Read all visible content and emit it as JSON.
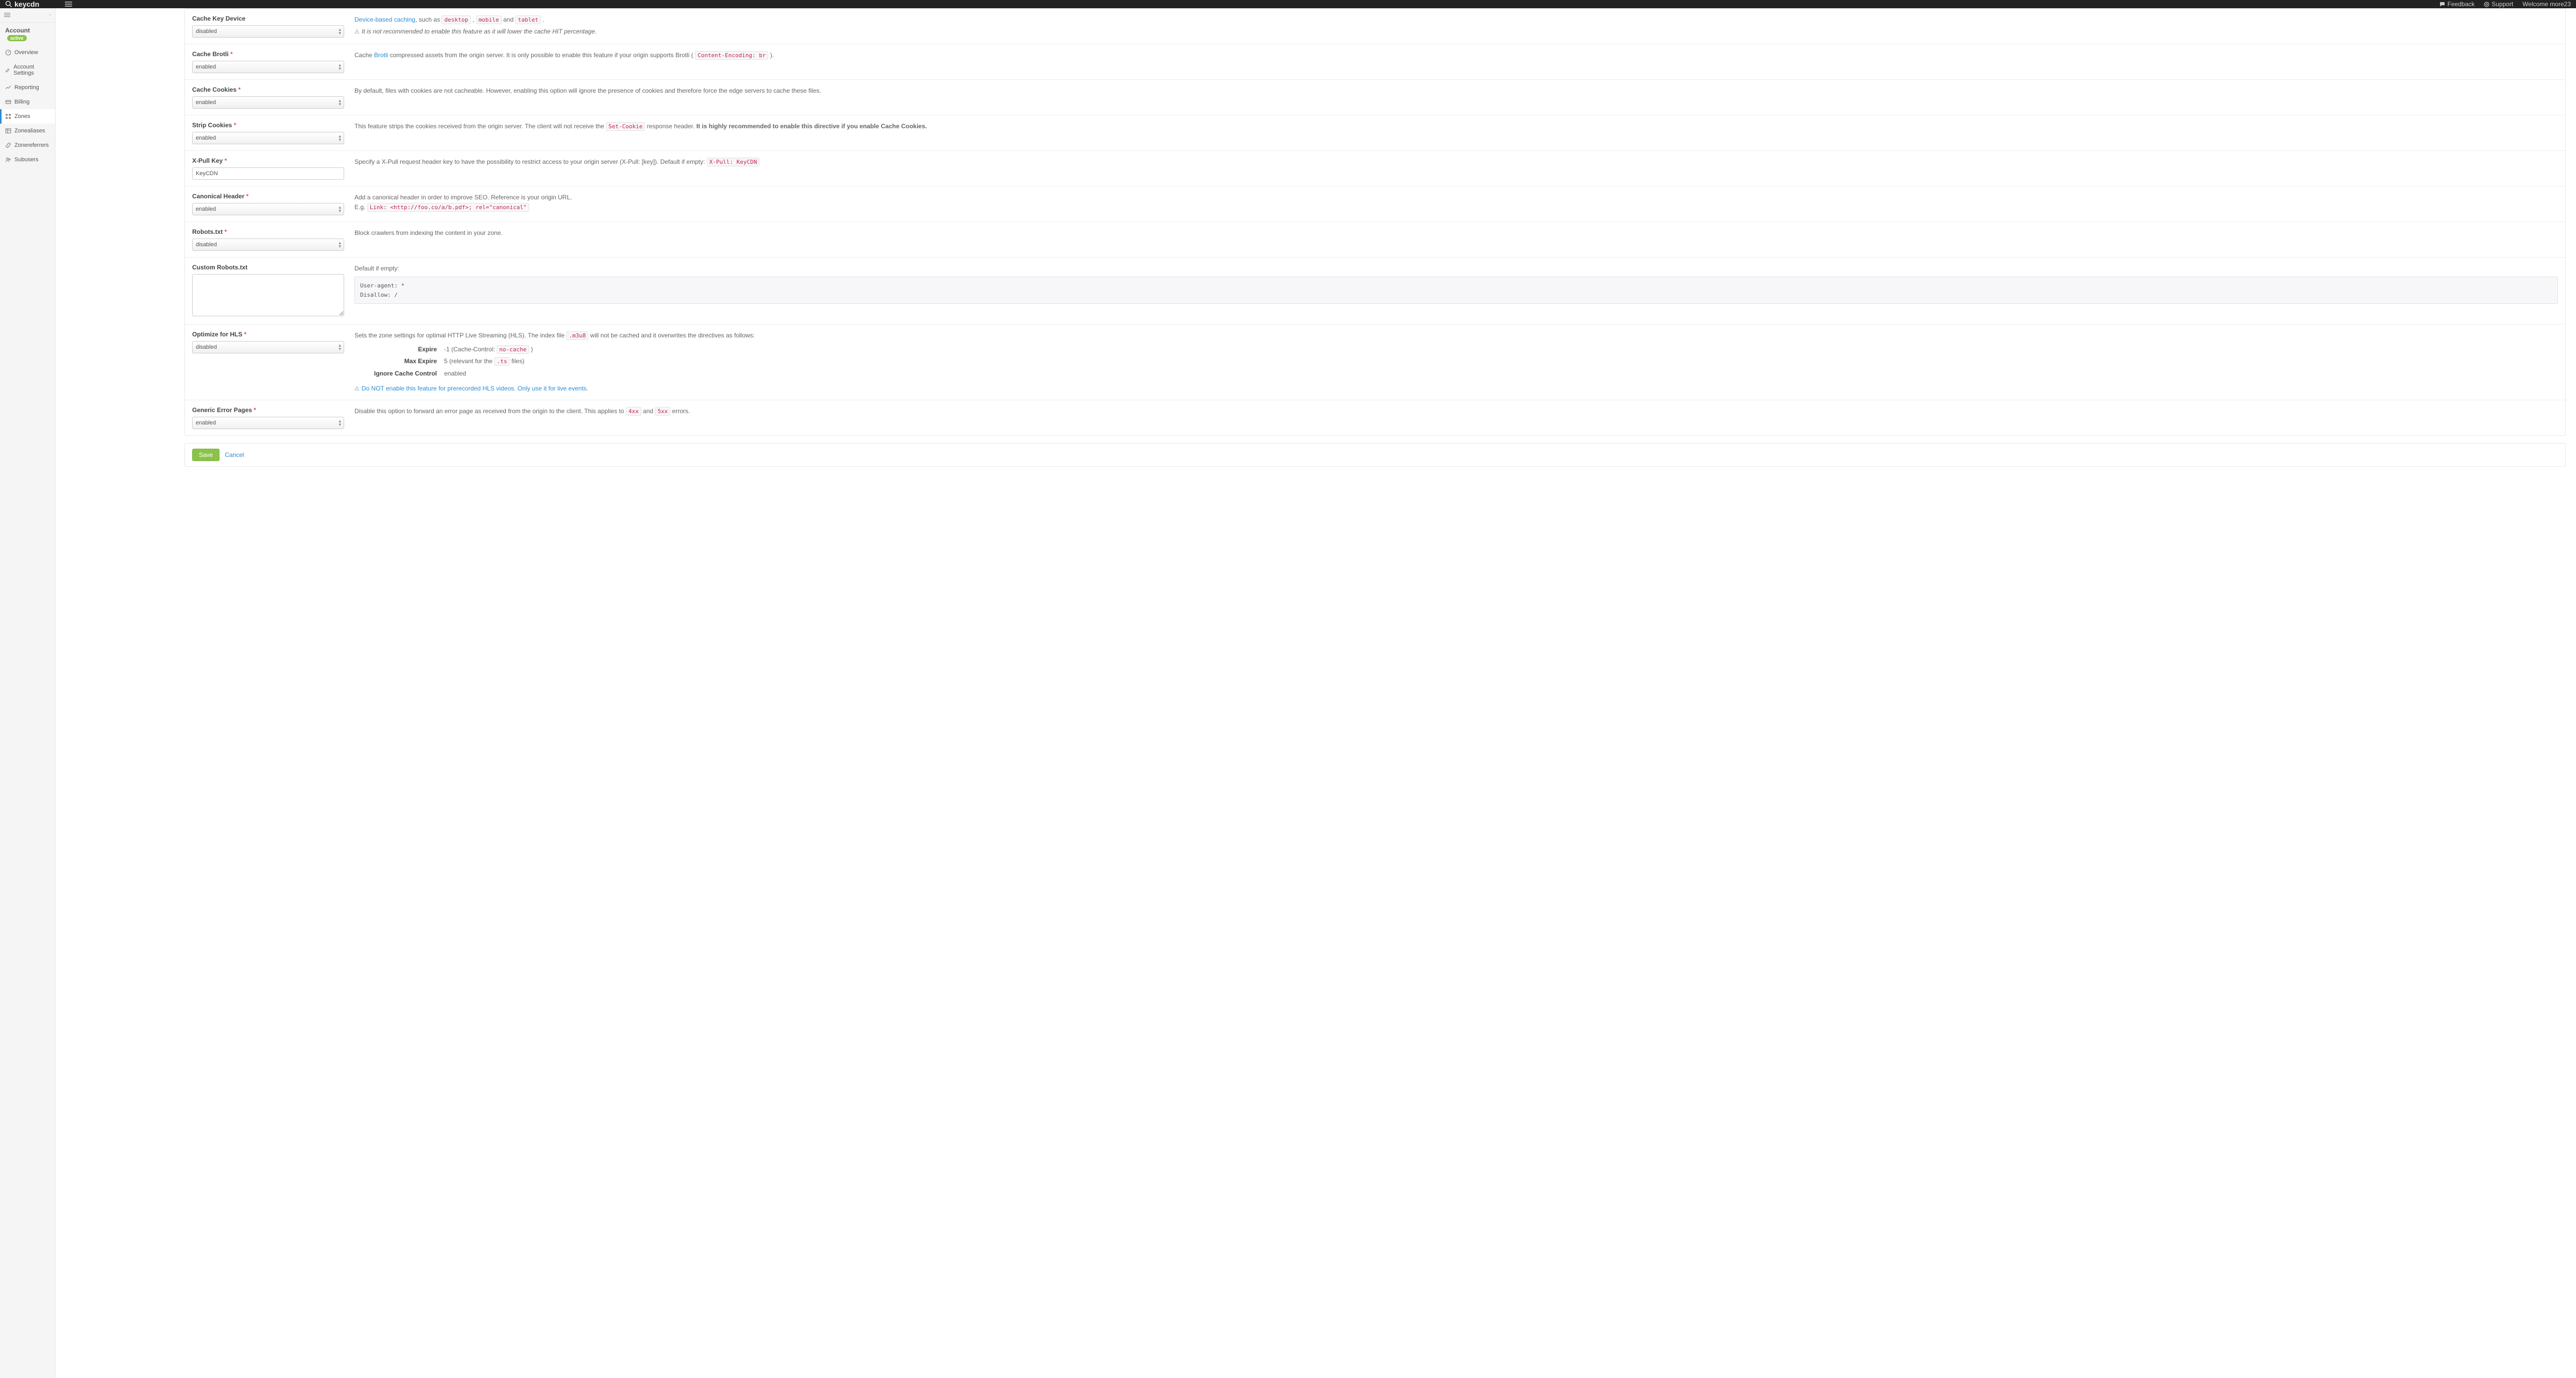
{
  "topbar": {
    "brand": "keycdn",
    "feedback": "Feedback",
    "support": "Support",
    "welcome": "Welcome more23"
  },
  "sidebar": {
    "section": "Account",
    "status": "active",
    "items": [
      {
        "label": "Overview",
        "icon": "dashboard"
      },
      {
        "label": "Account Settings",
        "icon": "edit"
      },
      {
        "label": "Reporting",
        "icon": "chart"
      },
      {
        "label": "Billing",
        "icon": "card"
      },
      {
        "label": "Zones",
        "icon": "grid",
        "active": true
      },
      {
        "label": "Zonealiases",
        "icon": "table"
      },
      {
        "label": "Zonereferrers",
        "icon": "link"
      },
      {
        "label": "Subusers",
        "icon": "users"
      }
    ]
  },
  "options": {
    "enabled": "enabled",
    "disabled": "disabled"
  },
  "rows": {
    "cacheKeyDevice": {
      "label": "Cache Key Device",
      "value": "disabled",
      "desc_link": "Device-based caching",
      "desc_rest": ", such as ",
      "codes": [
        "desktop",
        "mobile",
        "tablet"
      ],
      "and": " and ",
      "note": "It is not recommended to enable this feature as it will lower the cache HIT percentage."
    },
    "cacheBrotli": {
      "label": "Cache Brotli",
      "value": "enabled",
      "pre": "Cache ",
      "link": "Brotli",
      "mid": " compressed assets from the origin server. It is only possible to enable this feature if your origin supports Brotli ( ",
      "code": "Content-Encoding: br",
      "post": " )."
    },
    "cacheCookies": {
      "label": "Cache Cookies",
      "value": "enabled",
      "desc": "By default, files with cookies are not cacheable. However, enabling this option will ignore the presence of cookies and therefore force the edge servers to cache these files."
    },
    "stripCookies": {
      "label": "Strip Cookies",
      "value": "enabled",
      "pre": "This feature strips the cookies received from the origin server. The client will not receive the ",
      "code": "Set-Cookie",
      "mid": " response header. ",
      "bold": "It is highly recommended to enable this directive if you enable Cache Cookies."
    },
    "xpull": {
      "label": "X-Pull Key",
      "value": "KeyCDN",
      "desc": "Specify a X-Pull request header key to have the possibility to restrict access to your origin server (X-Pull: [key]). Default if empty: ",
      "code": "X-Pull: KeyCDN"
    },
    "canonical": {
      "label": "Canonical Header",
      "value": "enabled",
      "desc": "Add a canonical header in order to improve SEO. Reference is your origin URL.",
      "eg": "E.g. ",
      "code": "Link: <http://foo.co/a/b.pdf>; rel=\"canonical\""
    },
    "robots": {
      "label": "Robots.txt",
      "value": "disabled",
      "desc": "Block crawlers from indexing the content in your zone."
    },
    "customRobots": {
      "label": "Custom Robots.txt",
      "value": "",
      "desc": "Default if empty:",
      "codeblock": "User-agent: *\nDisallow: /"
    },
    "hls": {
      "label": "Optimize for HLS",
      "value": "disabled",
      "pre": "Sets the zone settings for optimal HTTP Live Streaming (HLS). The index file ",
      "code1": ".m3u8",
      "post": " will not be cached and it overwrites the directives as follows:",
      "expire_k": "Expire",
      "expire_v_pre": "-1 (Cache-Control: ",
      "expire_code": "no-cache",
      "expire_v_post": " )",
      "maxexp_k": "Max Expire",
      "maxexp_v_pre": "5 (relevant for the ",
      "maxexp_code": ".ts",
      "maxexp_v_post": " files)",
      "icc_k": "Ignore Cache Control",
      "icc_v": "enabled",
      "warn": "Do NOT enable this feature for prerecorded HLS videos. Only use it for live events."
    },
    "errorPages": {
      "label": "Generic Error Pages",
      "value": "enabled",
      "pre": "Disable this option to forward an error page as received from the origin to the client. This applies to ",
      "code1": "4xx",
      "and": " and ",
      "code2": "5xx",
      "post": " errors."
    }
  },
  "actions": {
    "save": "Save",
    "cancel": "Cancel"
  }
}
